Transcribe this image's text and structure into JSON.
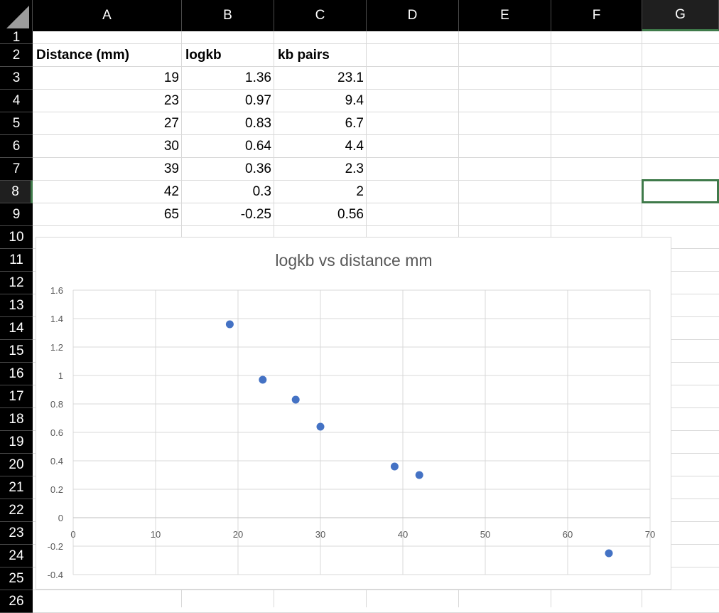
{
  "columns": [
    "A",
    "B",
    "C",
    "D",
    "E",
    "F",
    "G"
  ],
  "rows": [
    "1",
    "2",
    "3",
    "4",
    "5",
    "6",
    "7",
    "8",
    "9",
    "10",
    "11",
    "12",
    "13",
    "14",
    "15",
    "16",
    "17",
    "18",
    "19",
    "20",
    "21",
    "22",
    "23",
    "24",
    "25",
    "26"
  ],
  "table": {
    "headers": [
      "Distance (mm)",
      "logkb",
      "kb pairs"
    ],
    "rows": [
      [
        "19",
        "1.36",
        "23.1"
      ],
      [
        "23",
        "0.97",
        "9.4"
      ],
      [
        "27",
        "0.83",
        "6.7"
      ],
      [
        "30",
        "0.64",
        "4.4"
      ],
      [
        "39",
        "0.36",
        "2.3"
      ],
      [
        "42",
        "0.3",
        "2"
      ],
      [
        "65",
        "-0.25",
        "0.56"
      ]
    ]
  },
  "selection": {
    "column": "G",
    "row": "8"
  },
  "colors": {
    "marker": "#4472c4",
    "header_bg": "#000000",
    "selection": "#3f7a4a",
    "gridline": "#d9d9d9"
  },
  "chart_data": {
    "type": "scatter",
    "title": "logkb vs distance mm",
    "xlabel": "",
    "ylabel": "",
    "x": [
      19,
      23,
      27,
      30,
      39,
      42,
      65
    ],
    "y": [
      1.36,
      0.97,
      0.83,
      0.64,
      0.36,
      0.3,
      -0.25
    ],
    "xlim": [
      0,
      70
    ],
    "ylim": [
      -0.4,
      1.6
    ],
    "xticks": [
      "0",
      "10",
      "20",
      "30",
      "40",
      "50",
      "60",
      "70"
    ],
    "yticks": [
      "1.6",
      "1.4",
      "1.2",
      "1",
      "0.8",
      "0.6",
      "0.4",
      "0.2",
      "0",
      "-0.2",
      "-0.4"
    ],
    "grid": true,
    "legend": "none"
  }
}
